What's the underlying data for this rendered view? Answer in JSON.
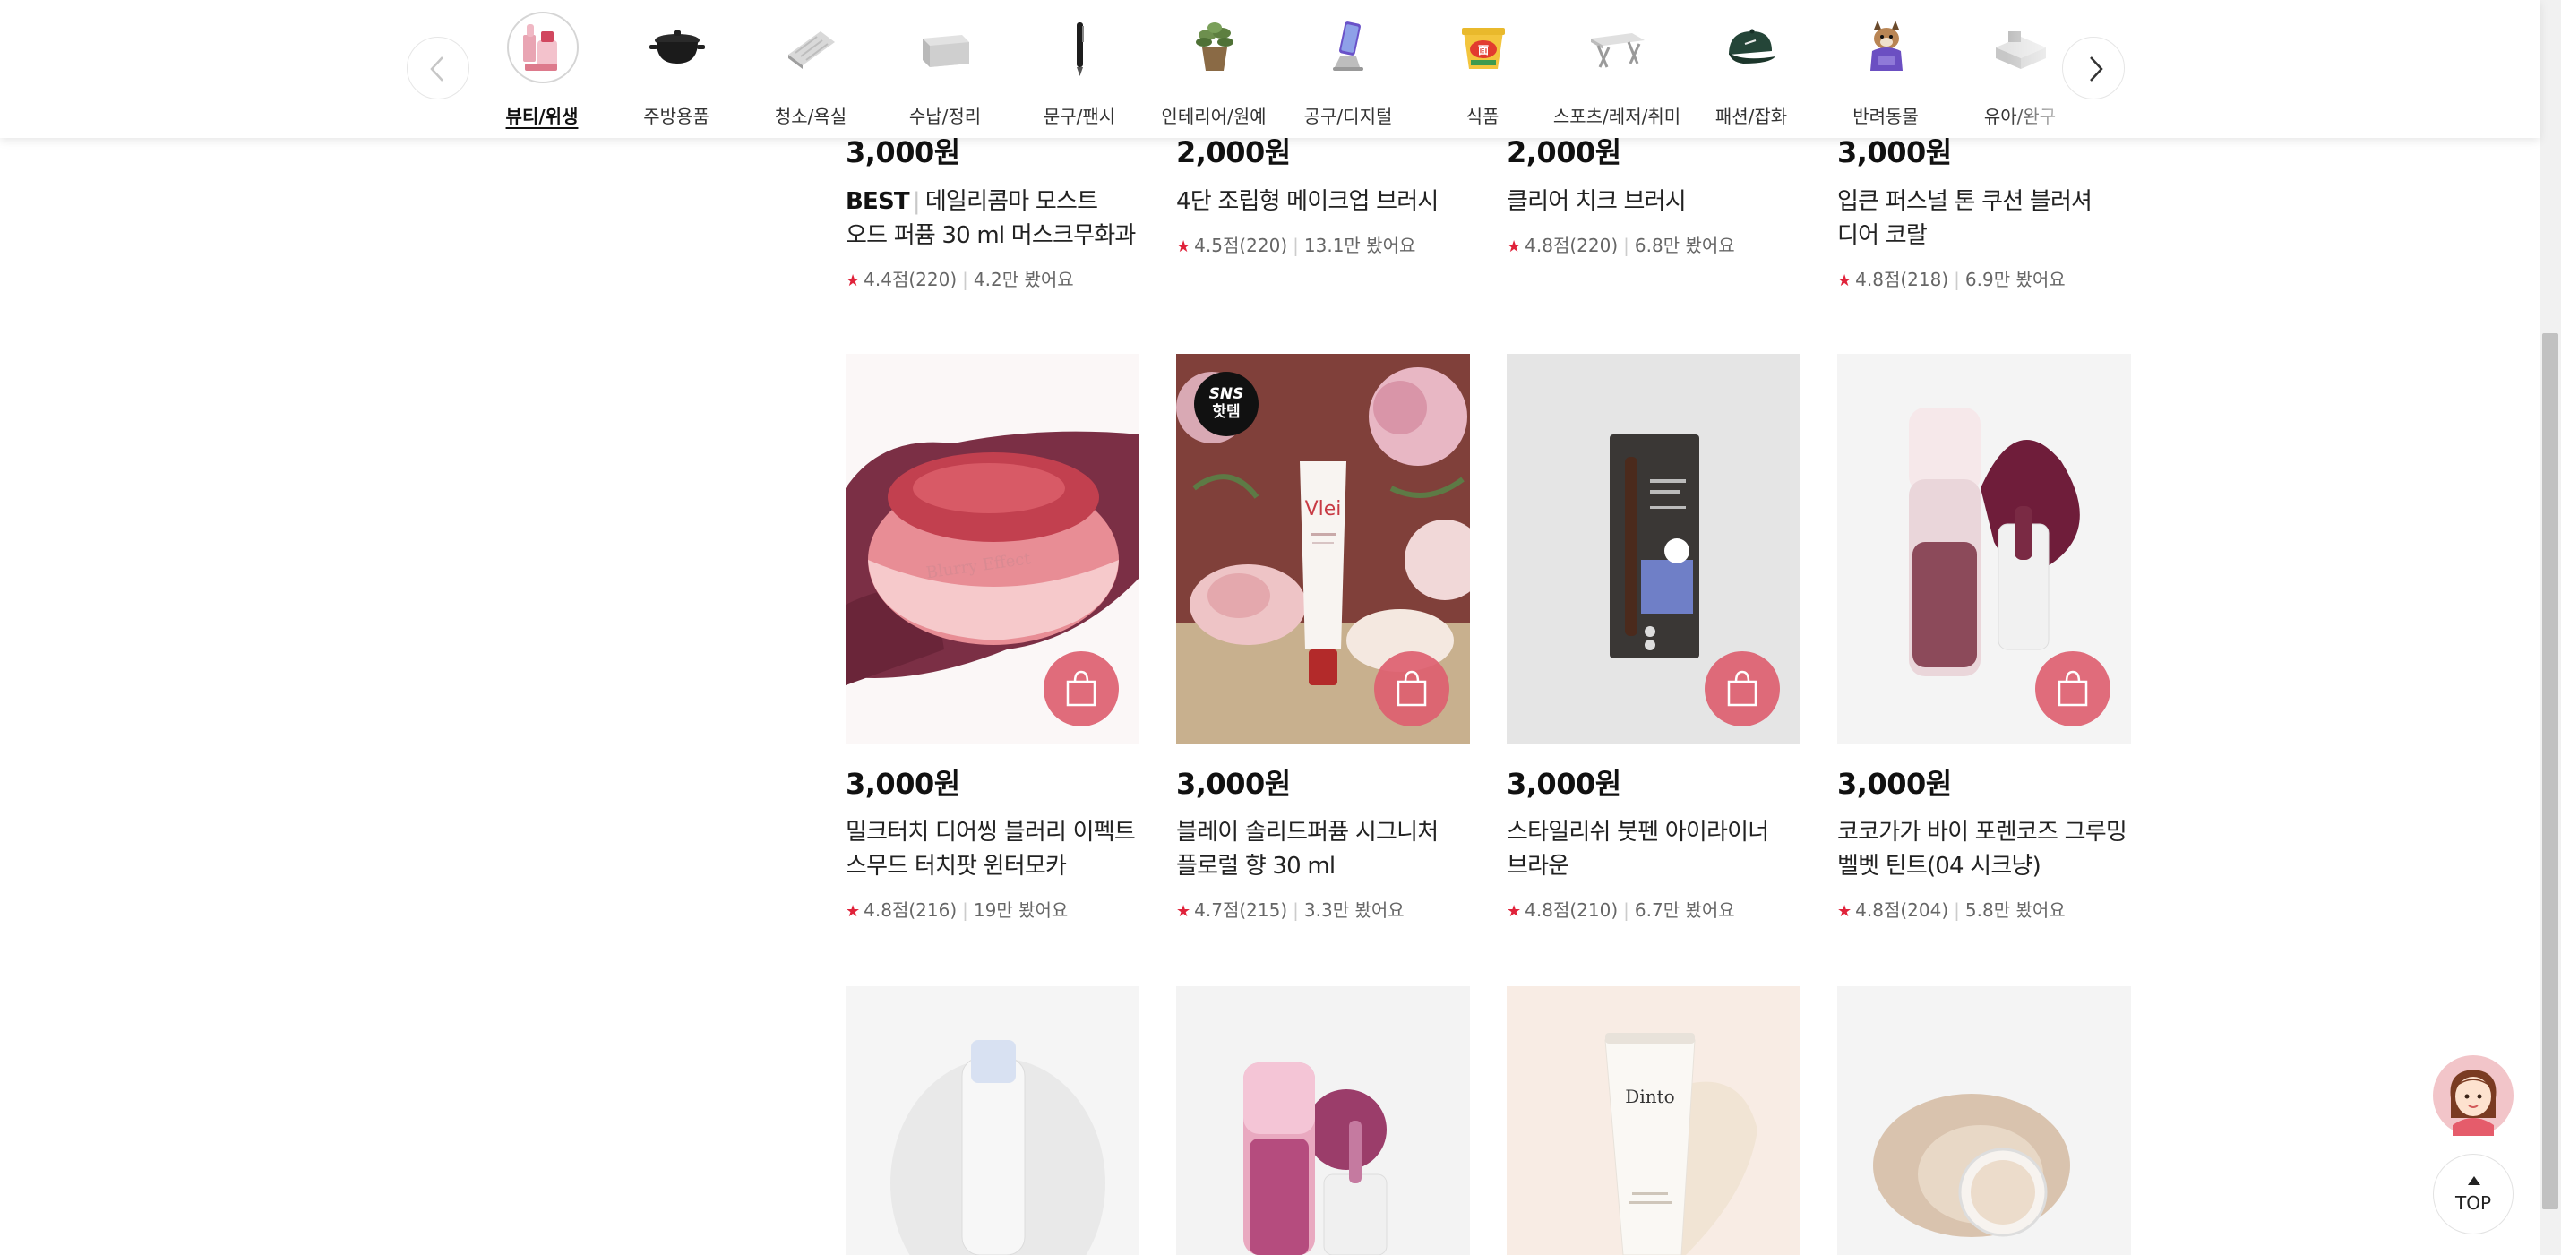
{
  "categories": [
    {
      "label": "뷰티/위생",
      "icon": "lipstick-cosmetics-icon",
      "active": true
    },
    {
      "label": "주방용품",
      "icon": "cooking-pot-icon"
    },
    {
      "label": "청소/욕실",
      "icon": "scrub-brush-icon"
    },
    {
      "label": "수납/정리",
      "icon": "storage-box-icon"
    },
    {
      "label": "문구/팬시",
      "icon": "pen-icon"
    },
    {
      "label": "인테리어/원예",
      "icon": "potted-plant-icon"
    },
    {
      "label": "공구/디지털",
      "icon": "phone-stand-icon"
    },
    {
      "label": "식품",
      "icon": "snack-cup-icon"
    },
    {
      "label": "스포츠/레저/취미",
      "icon": "folding-table-icon"
    },
    {
      "label": "패션/잡화",
      "icon": "cap-icon"
    },
    {
      "label": "반려동물",
      "icon": "pet-dog-icon"
    },
    {
      "label": "유아/완구",
      "icon": "toy-icon"
    }
  ],
  "products": [
    {
      "price": "3,000원",
      "badge": "BEST",
      "name": "데일리콤마 모스트 오드 퍼퓸 30 ml 머스크무화과",
      "rating": "4.4점(220)",
      "views": "4.2만 봤어요"
    },
    {
      "price": "2,000원",
      "name": "4단 조립형 메이크업 브러시",
      "rating": "4.5점(220)",
      "views": "13.1만 봤어요"
    },
    {
      "price": "2,000원",
      "name": "클리어 치크 브러시",
      "rating": "4.8점(220)",
      "views": "6.8만 봤어요"
    },
    {
      "price": "3,000원",
      "name": "입큰 퍼스널 톤 쿠션 블러셔 디어 코랄",
      "rating": "4.8점(218)",
      "views": "6.9만 봤어요"
    },
    {
      "price": "3,000원",
      "name": "밀크터치 디어씽 블러리 이펙트 스무드 터치팟 윈터모카",
      "rating": "4.8점(216)",
      "views": "19만 봤어요",
      "image": "berry-blush-pot"
    },
    {
      "price": "3,000원",
      "name": "블레이 솔리드퍼퓸 시그니처 플로럴 향 30 ml",
      "rating": "4.7점(215)",
      "views": "3.3만 봤어요",
      "image": "floral-perfume-tube",
      "sns_badge": [
        "SNS",
        "핫템"
      ],
      "brand": "Vlei"
    },
    {
      "price": "3,000원",
      "name": "스타일리쉬 붓펜 아이라이너 브라운",
      "rating": "4.8점(210)",
      "views": "6.7만 봤어요",
      "image": "eyeliner-pack"
    },
    {
      "price": "3,000원",
      "name": "코코가가 바이 포렌코즈 그루밍 벨벳 틴트(04 시크냥)",
      "rating": "4.8점(204)",
      "views": "5.8만 봤어요",
      "image": "velvet-tint"
    },
    {
      "image": "clear-serum-bottle"
    },
    {
      "image": "pink-lip-tint"
    },
    {
      "image": "foundation-tube",
      "brand": "Dinto"
    },
    {
      "image": "highlighter-pot"
    }
  ],
  "floating": {
    "top_label": "TOP",
    "avatar_icon": "chatbot-avatar-icon"
  },
  "colors": {
    "accent": "#dd6070",
    "star": "#e0223a"
  }
}
